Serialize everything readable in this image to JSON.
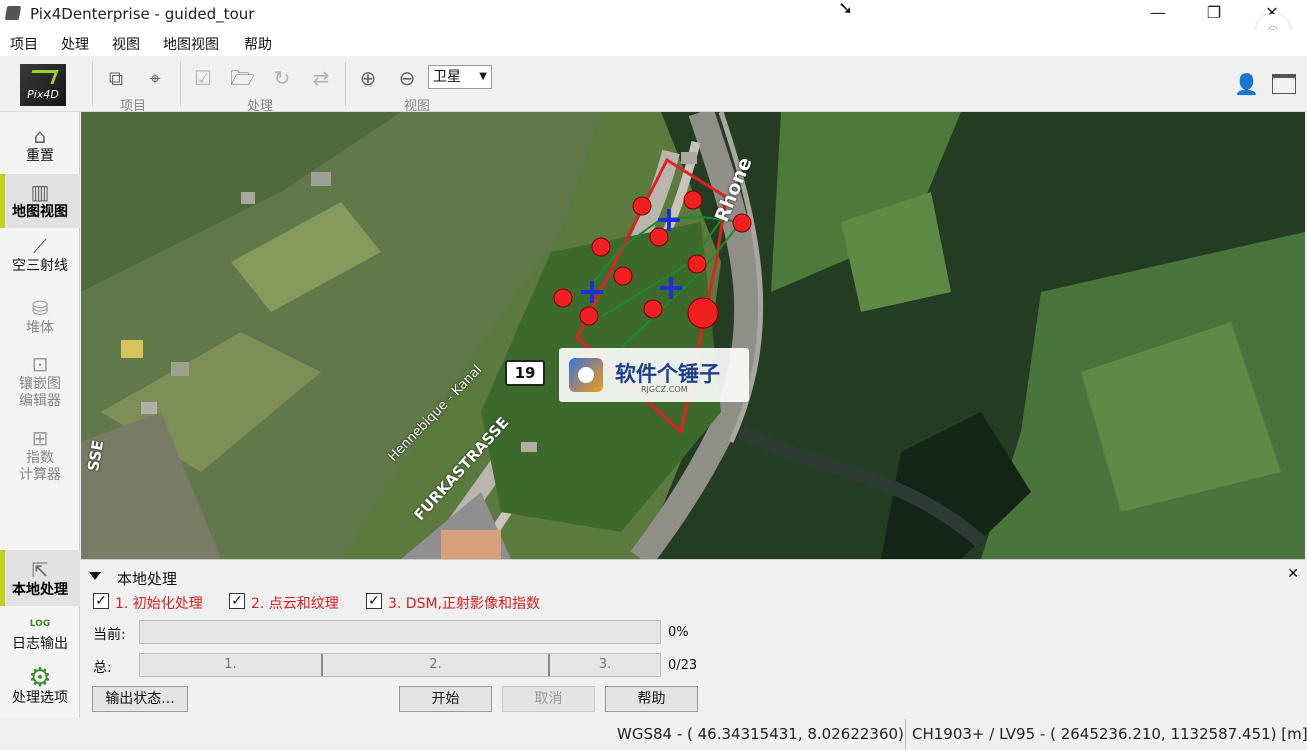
{
  "window": {
    "title": "Pix4Denterprise - guided_tour",
    "minimize_glyph": "—",
    "restore_glyph": "❐",
    "close_glyph": "✕"
  },
  "menubar": {
    "items": [
      "项目",
      "处理",
      "视图",
      "地图视图",
      "帮助"
    ]
  },
  "toolbar": {
    "logo_text": "Pix4D",
    "groups": [
      "项目",
      "处理",
      "视图"
    ],
    "layer_select": "卫星"
  },
  "sidebar": {
    "items": [
      {
        "label": "重置",
        "icon": "home-icon"
      },
      {
        "label": "地图视图",
        "icon": "map-icon"
      },
      {
        "label": "空三射线",
        "icon": "rays-icon"
      },
      {
        "label": "堆体",
        "icon": "volume-icon"
      },
      {
        "label": "镶嵌图",
        "label2": "编辑器",
        "icon": "mosaic-editor-icon"
      },
      {
        "label": "指数",
        "label2": "计算器",
        "icon": "index-calculator-icon"
      },
      {
        "label": "本地处理",
        "icon": "local-processing-icon"
      },
      {
        "label": "日志输出",
        "icon": "log-icon",
        "icon_text": "LOG"
      },
      {
        "label": "处理选项",
        "icon": "gear-icon"
      }
    ]
  },
  "map": {
    "road_sign": "19",
    "watermark_title": "软件个锤子",
    "watermark_sub": "RJGCZ.COM",
    "labels": [
      "Rhone",
      "Hennebique - Kanal",
      "FURKASTRASSE",
      "SSE"
    ]
  },
  "processing": {
    "title": "本地处理",
    "steps": [
      "1. 初始化处理",
      "2. 点云和纹理",
      "3. DSM,正射影像和指数"
    ],
    "check_glyph": "✓",
    "current_label": "当前:",
    "current_pct": "0%",
    "total_label": "总:",
    "segments": [
      "1.",
      "2.",
      "3."
    ],
    "total_count": "0/23",
    "buttons": {
      "output_status": "输出状态...",
      "start": "开始",
      "cancel": "取消",
      "help": "帮助"
    }
  },
  "status": {
    "wgs84": "WGS84 - ( 46.34315431,    8.02622360)",
    "ch1903": "CH1903+ / LV95 - (  2645236.210,    1132587.451) [m]"
  },
  "colors": {
    "accent": "#c2d11b",
    "step_red": "#d42020",
    "gcp_blue": "#1f2fd6",
    "marker_red": "#f02020"
  }
}
